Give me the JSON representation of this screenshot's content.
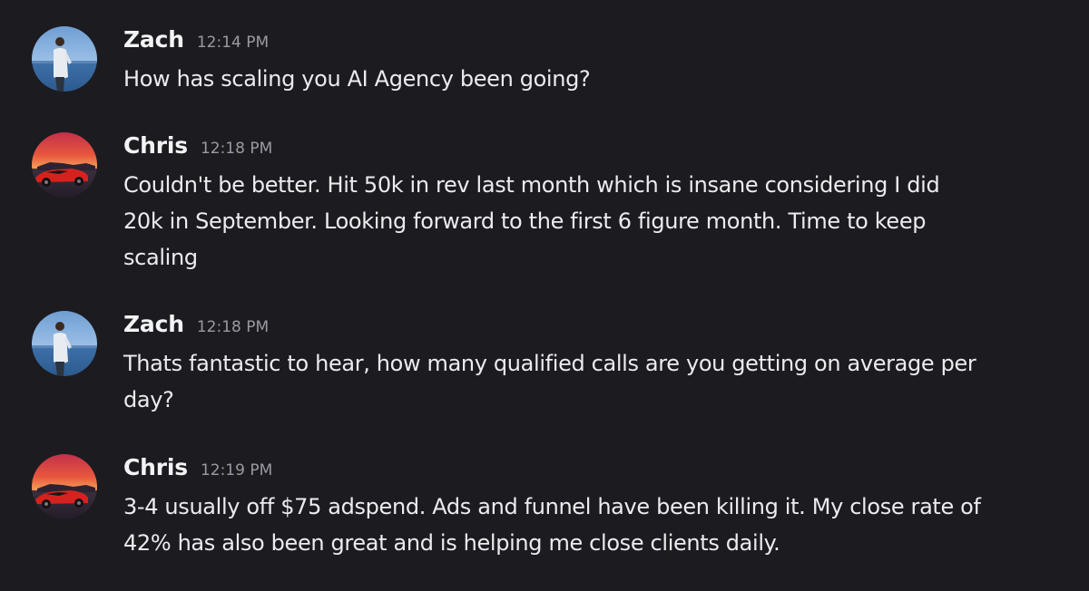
{
  "messages": [
    {
      "author": "Zach",
      "time": "12:14 PM",
      "avatar_icon": "profile-photo-person-seaside",
      "lines": [
        "How has scaling you AI Agency been going?"
      ]
    },
    {
      "author": "Chris",
      "time": "12:18 PM",
      "avatar_icon": "profile-photo-red-sports-car-sunset",
      "lines": [
        "Couldn't be better. Hit 50k in rev last month which is insane considering I did",
        "20k in September. Looking forward to the first 6 figure month. Time to keep",
        "scaling"
      ]
    },
    {
      "author": "Zach",
      "time": "12:18 PM",
      "avatar_icon": "profile-photo-person-seaside",
      "lines": [
        "Thats fantastic to hear, how many qualified calls are you getting on average per",
        "day?"
      ]
    },
    {
      "author": "Chris",
      "time": "12:19 PM",
      "avatar_icon": "profile-photo-red-sports-car-sunset",
      "lines": [
        "3-4 usually off $75 adspend. Ads and funnel have been killing it. My close rate of",
        "42% has also been great and is helping me close clients daily."
      ]
    }
  ]
}
